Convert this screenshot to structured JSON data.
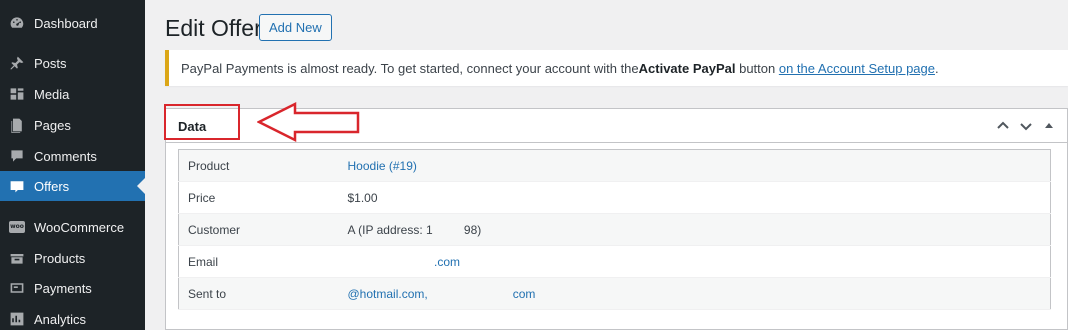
{
  "sidebar": {
    "items": [
      {
        "label": "Dashboard",
        "icon": "dashboard-icon"
      },
      {
        "label": "Posts",
        "icon": "pin-icon"
      },
      {
        "label": "Media",
        "icon": "media-icon"
      },
      {
        "label": "Pages",
        "icon": "pages-icon"
      },
      {
        "label": "Comments",
        "icon": "comment-icon"
      },
      {
        "label": "Offers",
        "icon": "offers-icon",
        "active": true
      },
      {
        "label": "WooCommerce",
        "icon": "woo-icon"
      },
      {
        "label": "Products",
        "icon": "products-icon"
      },
      {
        "label": "Payments",
        "icon": "payments-icon"
      },
      {
        "label": "Analytics",
        "icon": "analytics-icon"
      }
    ]
  },
  "header": {
    "title": "Edit Offer",
    "add_new_label": "Add New"
  },
  "notice": {
    "text_before": "PayPal Payments is almost ready. To get started, connect your account with the ",
    "bold": "Activate PayPal",
    "text_middle": " button ",
    "link": "on the Account Setup page",
    "text_after": "."
  },
  "box": {
    "title": "Data",
    "rows": [
      {
        "key": "Product",
        "value": "Hoodie (#19)",
        "link": true
      },
      {
        "key": "Price",
        "value": "$1.00",
        "link": false
      },
      {
        "key": "Customer",
        "value": "A (IP address: 1             98)",
        "link": false
      },
      {
        "key": "Email",
        "value": "                                    .com",
        "link": true
      },
      {
        "key": "Sent to",
        "value": "@hotmail.com,                                   com",
        "link": true
      }
    ]
  },
  "colors": {
    "sidebar_bg": "#1d2327",
    "active_bg": "#2271b1",
    "link": "#2271b1",
    "notice_border": "#dba617",
    "annotation_red": "#d9262c"
  }
}
